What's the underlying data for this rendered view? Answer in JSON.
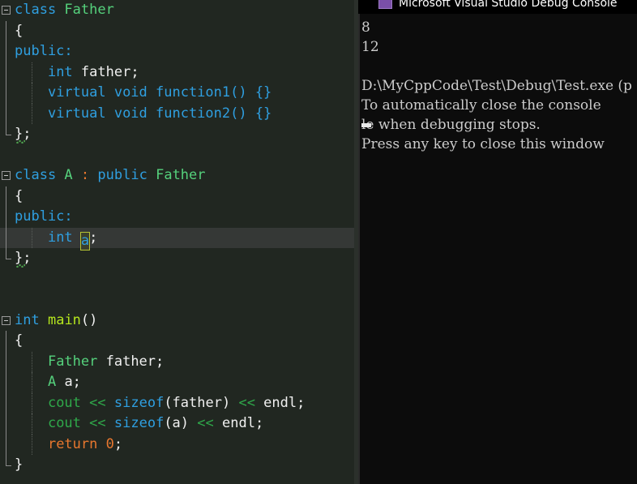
{
  "editor": {
    "name": "code-editor",
    "language": "cpp",
    "current_line_index": 11,
    "colors": {
      "background": "#212721",
      "current_line": "#353836",
      "keyword": "#2f9fe0",
      "type": "#55d17c",
      "function": "#b5e61d",
      "operator": "#e8772e",
      "stream": "#2fa84a",
      "plain": "#f0f0f0",
      "reference_highlight_border": "#b5c334"
    },
    "lines": [
      {
        "n": 1,
        "text": "class Father",
        "fold": "start"
      },
      {
        "n": 2,
        "text": "{",
        "fold": "mid"
      },
      {
        "n": 3,
        "text": "public:",
        "fold": "mid"
      },
      {
        "n": 4,
        "text": "    int father;",
        "fold": "mid"
      },
      {
        "n": 5,
        "text": "    virtual void function1() {}",
        "fold": "mid"
      },
      {
        "n": 6,
        "text": "    virtual void function2() {}",
        "fold": "mid"
      },
      {
        "n": 7,
        "text": "};",
        "fold": "end"
      },
      {
        "n": 8,
        "text": "",
        "fold": "none"
      },
      {
        "n": 9,
        "text": "class A : public Father",
        "fold": "start"
      },
      {
        "n": 10,
        "text": "{",
        "fold": "mid"
      },
      {
        "n": 11,
        "text": "public:",
        "fold": "mid"
      },
      {
        "n": 12,
        "text": "    int a;",
        "fold": "mid"
      },
      {
        "n": 13,
        "text": "};",
        "fold": "end"
      },
      {
        "n": 14,
        "text": "",
        "fold": "none"
      },
      {
        "n": 15,
        "text": "",
        "fold": "none"
      },
      {
        "n": 16,
        "text": "int main()",
        "fold": "start"
      },
      {
        "n": 17,
        "text": "{",
        "fold": "mid"
      },
      {
        "n": 18,
        "text": "    Father father;",
        "fold": "mid"
      },
      {
        "n": 19,
        "text": "    A a;",
        "fold": "mid"
      },
      {
        "n": 20,
        "text": "    cout << sizeof(father) << endl;",
        "fold": "mid"
      },
      {
        "n": 21,
        "text": "    cout << sizeof(a) << endl;",
        "fold": "mid"
      },
      {
        "n": 22,
        "text": "    return 0;",
        "fold": "mid"
      },
      {
        "n": 23,
        "text": "}",
        "fold": "end"
      }
    ],
    "highlighted_identifier": "a"
  },
  "console": {
    "title": "Microsoft Visual Studio Debug Console",
    "icon": "visual-studio-icon",
    "background": "#0c0c0c",
    "lines": [
      "8",
      "12",
      "",
      "D:\\MyCppCode\\Test\\Debug\\Test.exe (p",
      "To automatically close the console",
      "le when debugging stops.",
      "Press any key to close this window"
    ]
  },
  "tokens": {
    "l1": [
      [
        "class ",
        "t-kw"
      ],
      [
        "Father",
        "t-type"
      ]
    ],
    "l2": [
      [
        "{",
        "t-punct"
      ]
    ],
    "l3": [
      [
        "public",
        "t-kw"
      ],
      [
        ":",
        "t-kw"
      ]
    ],
    "l4": [
      [
        "    ",
        "t-plain"
      ],
      [
        "int",
        "t-kw"
      ],
      [
        " father;",
        "t-plain"
      ]
    ],
    "l5": [
      [
        "    ",
        "t-plain"
      ],
      [
        "virtual void function1() {}",
        "t-kw"
      ]
    ],
    "l6": [
      [
        "    ",
        "t-plain"
      ],
      [
        "virtual void function2() {}",
        "t-kw"
      ]
    ],
    "l7": [
      [
        "};",
        "t-punct"
      ]
    ],
    "l9": [
      [
        "class ",
        "t-kw"
      ],
      [
        "A",
        "t-type"
      ],
      [
        " ",
        "t-plain"
      ],
      [
        ":",
        "t-op"
      ],
      [
        " ",
        "t-plain"
      ],
      [
        "public",
        "t-kw"
      ],
      [
        " ",
        "t-plain"
      ],
      [
        "Father",
        "t-type"
      ]
    ],
    "l10": [
      [
        "{",
        "t-punct"
      ]
    ],
    "l11": [
      [
        "public",
        "t-kw"
      ],
      [
        ":",
        "t-kw"
      ]
    ],
    "l12": [
      [
        "    ",
        "t-plain"
      ],
      [
        "int",
        "t-kw"
      ],
      [
        " ",
        "t-plain"
      ],
      [
        "a",
        "hl"
      ],
      [
        ";",
        "t-plain"
      ]
    ],
    "l13": [
      [
        "};",
        "t-punct"
      ]
    ],
    "l16": [
      [
        "int",
        "t-kw"
      ],
      [
        " ",
        "t-plain"
      ],
      [
        "main",
        "t-fn"
      ],
      [
        "()",
        "t-plain"
      ]
    ],
    "l17": [
      [
        "{",
        "t-punct"
      ]
    ],
    "l18": [
      [
        "    ",
        "t-plain"
      ],
      [
        "Father",
        "t-type"
      ],
      [
        " father;",
        "t-plain"
      ]
    ],
    "l19": [
      [
        "    ",
        "t-plain"
      ],
      [
        "A",
        "t-type"
      ],
      [
        " a;",
        "t-plain"
      ]
    ],
    "l20": [
      [
        "    ",
        "t-plain"
      ],
      [
        "cout",
        "t-green"
      ],
      [
        " ",
        "t-plain"
      ],
      [
        "<<",
        "t-green"
      ],
      [
        " ",
        "t-plain"
      ],
      [
        "sizeof",
        "t-blue2"
      ],
      [
        "(father)",
        "t-plain"
      ],
      [
        " ",
        "t-plain"
      ],
      [
        "<<",
        "t-green"
      ],
      [
        " endl;",
        "t-plain"
      ]
    ],
    "l21": [
      [
        "    ",
        "t-plain"
      ],
      [
        "cout",
        "t-green"
      ],
      [
        " ",
        "t-plain"
      ],
      [
        "<<",
        "t-green"
      ],
      [
        " ",
        "t-plain"
      ],
      [
        "sizeof",
        "t-blue2"
      ],
      [
        "(a)",
        "t-plain"
      ],
      [
        " ",
        "t-plain"
      ],
      [
        "<<",
        "t-green"
      ],
      [
        " endl;",
        "t-plain"
      ]
    ],
    "l22": [
      [
        "    ",
        "t-plain"
      ],
      [
        "return",
        "t-op"
      ],
      [
        " ",
        "t-plain"
      ],
      [
        "0",
        "t-num"
      ],
      [
        ";",
        "t-plain"
      ]
    ],
    "l23": [
      [
        "}",
        "t-punct"
      ]
    ]
  }
}
